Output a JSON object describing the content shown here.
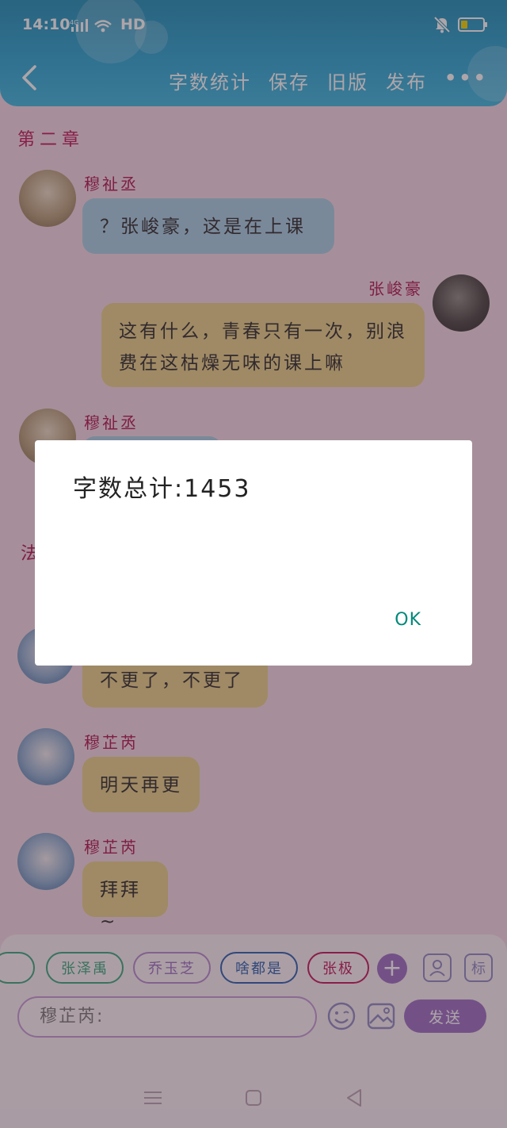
{
  "status": {
    "time": "14:10",
    "network": "HD",
    "signal_label": "4G"
  },
  "toolbar": {
    "word_count": "字数统计",
    "save": "保存",
    "old_version": "旧版",
    "publish": "发布",
    "more": "•••"
  },
  "chapter": "第二章",
  "messages": [
    {
      "sender": "穆祉丞",
      "text": "？张峻豪，这是在上课",
      "side": "left"
    },
    {
      "sender": "张峻豪",
      "text": "这有什么，青春只有一次，别浪费在这枯燥无味的课上嘛",
      "side": "right"
    },
    {
      "sender": "穆祉丞",
      "text": "",
      "side": "left"
    },
    {
      "sender": "",
      "text": "不更了，不更了",
      "side": "left"
    },
    {
      "sender": "穆芷芮",
      "text": "明天再更",
      "side": "left"
    },
    {
      "sender": "穆芷芮",
      "text": "拜拜~",
      "side": "left"
    }
  ],
  "partial_chapter_char": "法",
  "dialog": {
    "text": "字数总计:1453",
    "ok": "OK"
  },
  "chips": [
    "张泽禹",
    "乔玉芝",
    "啥都是",
    "张极"
  ],
  "chip_colors": [
    "#3aa87e",
    "#b58bd0",
    "#2b5fb0",
    "#c2185b"
  ],
  "input": {
    "value": "穆芷芮:"
  },
  "icons": {
    "user": "user-icon",
    "tag": "标",
    "emoji": "emoji-icon",
    "image": "image-icon"
  },
  "send_label": "发送",
  "colors": {
    "header": "#2aa8d6",
    "name": "#b0154f",
    "accent": "#9c6fc4",
    "ok": "#00897b"
  }
}
